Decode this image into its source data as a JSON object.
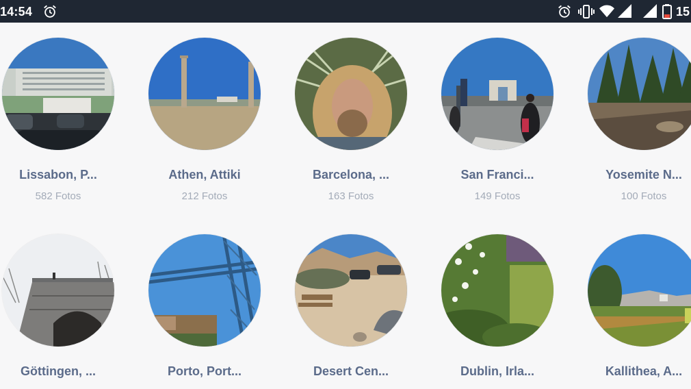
{
  "status_bar": {
    "time": "14:54",
    "icons": [
      "alarm-icon",
      "alarm-icon",
      "vibrate-icon",
      "wifi-icon",
      "signal-icon",
      "signal-icon",
      "battery-icon"
    ],
    "battery": "15"
  },
  "albums": [
    {
      "title": "Lissabon, P...",
      "count": "582 Fotos"
    },
    {
      "title": "Athen, Attiki",
      "count": "212 Fotos"
    },
    {
      "title": "Barcelona, ...",
      "count": "163 Fotos"
    },
    {
      "title": "San Franci...",
      "count": "149 Fotos"
    },
    {
      "title": "Yosemite N...",
      "count": "100 Fotos"
    },
    {
      "title": "Göttingen, ...",
      "count": ""
    },
    {
      "title": "Porto, Port...",
      "count": ""
    },
    {
      "title": "Desert Cen...",
      "count": ""
    },
    {
      "title": "Dublin, Irla...",
      "count": ""
    },
    {
      "title": "Kallithea, A...",
      "count": ""
    }
  ],
  "colors": {
    "status_bar_bg": "#1f2733",
    "page_bg": "#f7f7f8",
    "title_text": "#5b6b8a",
    "count_text": "#a3abb8",
    "battery_low": "#e84b3c"
  }
}
